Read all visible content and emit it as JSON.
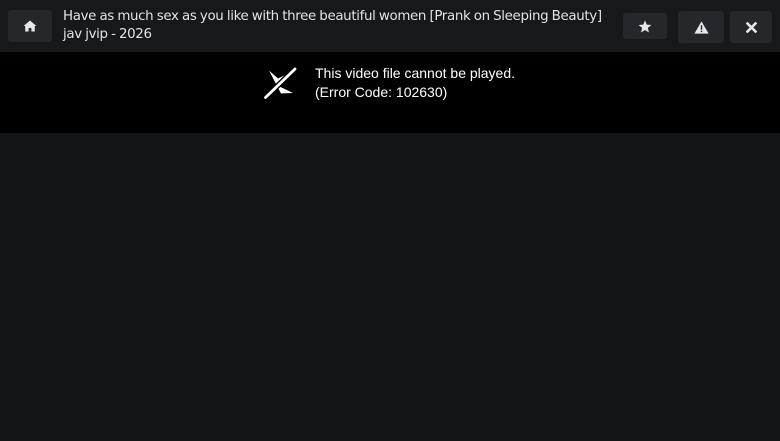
{
  "header": {
    "title": "Have as much sex as you like with three beautiful women [Prank on Sleeping Beauty] jav jvip - 2026",
    "buttons": {
      "home_icon": "home-icon",
      "favorite_icon": "star-icon",
      "report_icon": "warning-icon",
      "close_icon": "close-icon"
    }
  },
  "player": {
    "error_message": "This video file cannot be played.",
    "error_code": "(Error Code: 102630)",
    "error_icon": "video-off-icon"
  },
  "colors": {
    "page_bg": "#131416",
    "topbar_bg": "#16181b",
    "button_bg": "#24272b",
    "player_bg": "#000000"
  }
}
